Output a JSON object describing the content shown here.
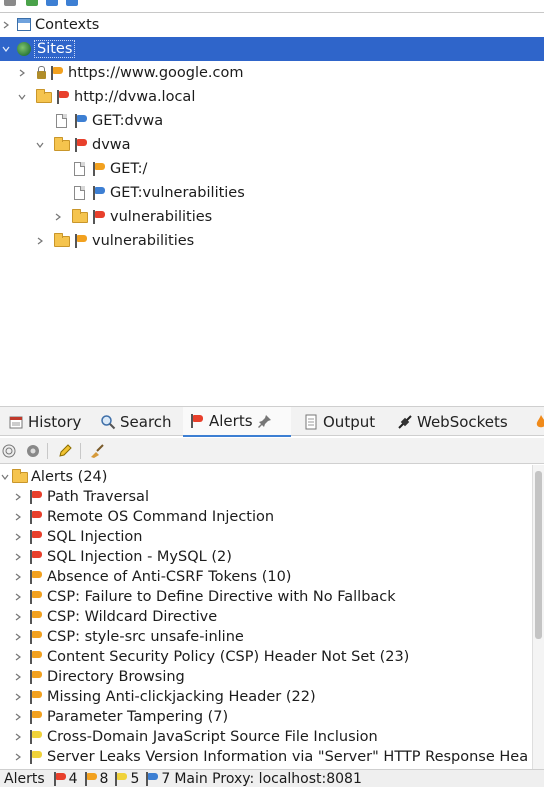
{
  "sites_tree": {
    "contexts_label": "Contexts",
    "sites_label": "Sites",
    "nodes": [
      {
        "label": "https://www.google.com"
      },
      {
        "label": "http://dvwa.local"
      },
      {
        "label": "GET:dvwa"
      },
      {
        "label": "dvwa"
      },
      {
        "label": "GET:/"
      },
      {
        "label": "GET:vulnerabilities"
      },
      {
        "label": "vulnerabilities"
      },
      {
        "label": "vulnerabilities"
      }
    ]
  },
  "tabs": [
    {
      "label": "History",
      "icon": "history-icon"
    },
    {
      "label": "Search",
      "icon": "search-icon"
    },
    {
      "label": "Alerts",
      "icon": "alert-flag-icon",
      "active": true
    },
    {
      "label": "Output",
      "icon": "output-icon"
    },
    {
      "label": "WebSockets",
      "icon": "websockets-icon"
    }
  ],
  "alerts": {
    "root_label": "Alerts (24)",
    "items": [
      {
        "label": "Path Traversal",
        "risk": "high"
      },
      {
        "label": "Remote OS Command Injection",
        "risk": "high"
      },
      {
        "label": "SQL Injection",
        "risk": "high"
      },
      {
        "label": "SQL Injection - MySQL (2)",
        "risk": "high"
      },
      {
        "label": "Absence of Anti-CSRF Tokens (10)",
        "risk": "medium"
      },
      {
        "label": "CSP: Failure to Define Directive with No Fallback",
        "risk": "medium"
      },
      {
        "label": "CSP: Wildcard Directive",
        "risk": "medium"
      },
      {
        "label": "CSP: style-src unsafe-inline",
        "risk": "medium"
      },
      {
        "label": "Content Security Policy (CSP) Header Not Set (23)",
        "risk": "medium"
      },
      {
        "label": "Directory Browsing",
        "risk": "medium"
      },
      {
        "label": "Missing Anti-clickjacking Header (22)",
        "risk": "medium"
      },
      {
        "label": "Parameter Tampering (7)",
        "risk": "medium"
      },
      {
        "label": "Cross-Domain JavaScript Source File Inclusion",
        "risk": "low"
      },
      {
        "label": "Server Leaks Version Information via \"Server\" HTTP Response Hea",
        "risk": "low"
      }
    ]
  },
  "statusbar": {
    "alerts_label": "Alerts",
    "high_count": "4",
    "medium_count": "8",
    "low_count": "5",
    "info_count": "7",
    "proxy_label": "Main Proxy: localhost:8081"
  },
  "colors": {
    "high": "#e8402c",
    "medium": "#f2a11f",
    "low": "#f0d23a",
    "info": "#3d7fd3",
    "selection": "#2f65ca"
  }
}
